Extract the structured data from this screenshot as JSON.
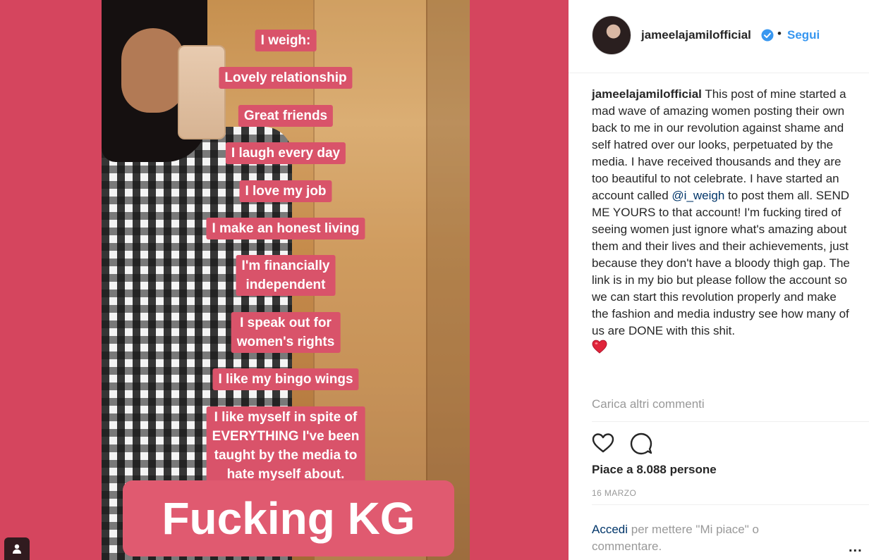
{
  "post_image": {
    "story_lines": [
      "I weigh:",
      "Lovely relationship",
      "Great friends",
      "I laugh every day",
      "I love my job",
      "I make an honest living",
      "I'm financially\nindependent",
      "I speak out for\nwomen's rights",
      "I like my bingo wings",
      "I like myself in spite of\nEVERYTHING I've been\ntaught by the media  to\nhate myself about."
    ],
    "big_text": "Fucking KG",
    "user_tag_icon": "person-icon"
  },
  "header": {
    "username": "jameelajamilofficial",
    "verified_icon": "verified-badge-icon",
    "separator": "•",
    "follow_label": "Segui"
  },
  "comment": {
    "username": "jameelajamilofficial",
    "text_before_mention": " This post of mine started a mad wave of amazing women posting their own back to me in our revolution against shame and self hatred over our looks, perpetuated by the media. I have received thousands and they are too beautiful to not celebrate. I have started an account called ",
    "mention": "@i_weigh",
    "text_after_mention": " to post them all. SEND ME YOURS to that account! I'm fucking tired of seeing women just ignore what's amazing about them and their lives and their achievements, just because they don't have a bloody thigh gap. The link is in my bio but please follow the account so we can start this revolution properly and make the fashion and media industry see how many of us are DONE with this shit.",
    "emoji": "red-heart-emoji"
  },
  "load_more_label": "Carica altri commenti",
  "actions": {
    "like_icon": "heart-outline-icon",
    "comment_icon": "comment-bubble-icon"
  },
  "likes_text": "Piace a 8.088 persone",
  "date_text": "16 MARZO",
  "login_prompt": {
    "link_label": "Accedi",
    "rest_text": " per mettere \"Mi piace\" o commentare."
  },
  "more_options_label": "...",
  "colors": {
    "background_magenta": "#d5455e",
    "tag_pink": "#d9536a",
    "link_blue": "#3897f0",
    "link_dark": "#003569",
    "muted_gray": "#999999"
  }
}
